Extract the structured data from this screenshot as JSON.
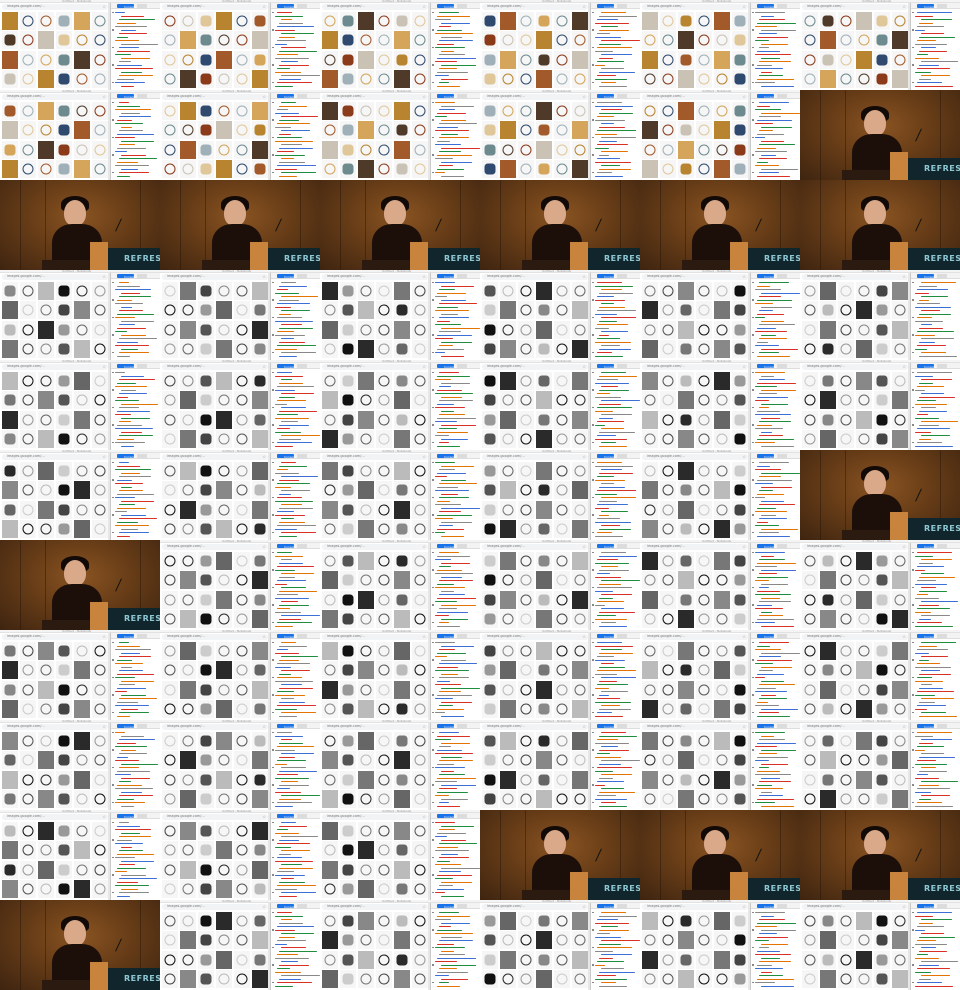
{
  "sheet": {
    "title": "",
    "columns": 6,
    "rows": 11
  },
  "screen_texts": {
    "url": "images.google.com/…",
    "window_title": "Untitled - Notebook",
    "devtools_tab": "Console",
    "devtools_tab_2": "Sources"
  },
  "video_texts": {
    "brand": "REFRESH"
  },
  "thumbnails": [
    {
      "kind": "screen",
      "variant": "color"
    },
    {
      "kind": "screen",
      "variant": "color"
    },
    {
      "kind": "screen",
      "variant": "color"
    },
    {
      "kind": "screen",
      "variant": "color"
    },
    {
      "kind": "screen",
      "variant": "color"
    },
    {
      "kind": "screen",
      "variant": "color"
    },
    {
      "kind": "screen",
      "variant": "color"
    },
    {
      "kind": "screen",
      "variant": "color"
    },
    {
      "kind": "screen",
      "variant": "color"
    },
    {
      "kind": "screen",
      "variant": "color"
    },
    {
      "kind": "screen",
      "variant": "color"
    },
    {
      "kind": "video",
      "variant": "speaker"
    },
    {
      "kind": "video",
      "variant": "speaker"
    },
    {
      "kind": "video",
      "variant": "speaker"
    },
    {
      "kind": "video",
      "variant": "speaker"
    },
    {
      "kind": "video",
      "variant": "speaker"
    },
    {
      "kind": "video",
      "variant": "speaker"
    },
    {
      "kind": "video",
      "variant": "speaker"
    },
    {
      "kind": "screen",
      "variant": "mono"
    },
    {
      "kind": "screen",
      "variant": "mono"
    },
    {
      "kind": "screen",
      "variant": "mono"
    },
    {
      "kind": "screen",
      "variant": "mono"
    },
    {
      "kind": "screen",
      "variant": "mono"
    },
    {
      "kind": "screen",
      "variant": "mono"
    },
    {
      "kind": "screen",
      "variant": "mono"
    },
    {
      "kind": "screen",
      "variant": "mono"
    },
    {
      "kind": "screen",
      "variant": "mono"
    },
    {
      "kind": "screen",
      "variant": "mono"
    },
    {
      "kind": "screen",
      "variant": "mono"
    },
    {
      "kind": "screen",
      "variant": "mono"
    },
    {
      "kind": "screen",
      "variant": "mono"
    },
    {
      "kind": "screen",
      "variant": "mono"
    },
    {
      "kind": "screen",
      "variant": "mono"
    },
    {
      "kind": "screen",
      "variant": "mono"
    },
    {
      "kind": "screen",
      "variant": "mono"
    },
    {
      "kind": "video",
      "variant": "speaker"
    },
    {
      "kind": "video",
      "variant": "speaker"
    },
    {
      "kind": "screen",
      "variant": "mono"
    },
    {
      "kind": "screen",
      "variant": "mono"
    },
    {
      "kind": "screen",
      "variant": "mono"
    },
    {
      "kind": "screen",
      "variant": "mono"
    },
    {
      "kind": "screen",
      "variant": "mono"
    },
    {
      "kind": "screen",
      "variant": "mono"
    },
    {
      "kind": "screen",
      "variant": "mono"
    },
    {
      "kind": "screen",
      "variant": "mono"
    },
    {
      "kind": "screen",
      "variant": "mono"
    },
    {
      "kind": "screen",
      "variant": "mono"
    },
    {
      "kind": "screen",
      "variant": "mono"
    },
    {
      "kind": "screen",
      "variant": "mono"
    },
    {
      "kind": "screen",
      "variant": "mono"
    },
    {
      "kind": "screen",
      "variant": "mono"
    },
    {
      "kind": "screen",
      "variant": "mono"
    },
    {
      "kind": "screen",
      "variant": "mono"
    },
    {
      "kind": "screen",
      "variant": "mono"
    },
    {
      "kind": "screen",
      "variant": "mono"
    },
    {
      "kind": "screen",
      "variant": "mono"
    },
    {
      "kind": "screen",
      "variant": "mono"
    },
    {
      "kind": "video",
      "variant": "speaker"
    },
    {
      "kind": "video",
      "variant": "speaker"
    },
    {
      "kind": "video",
      "variant": "speaker"
    },
    {
      "kind": "video",
      "variant": "speaker"
    },
    {
      "kind": "screen",
      "variant": "mono"
    },
    {
      "kind": "screen",
      "variant": "mono"
    },
    {
      "kind": "screen",
      "variant": "mono"
    },
    {
      "kind": "screen",
      "variant": "mono"
    },
    {
      "kind": "screen",
      "variant": "mono"
    }
  ],
  "colors": {
    "devtools_accent": "#1a73e8",
    "code_blue": "#3b6fd6",
    "code_red": "#d93025",
    "code_green": "#1e8e3e",
    "code_orange": "#e37400",
    "video_wood": "#8a5422",
    "video_brand": "#8fc7d3"
  }
}
